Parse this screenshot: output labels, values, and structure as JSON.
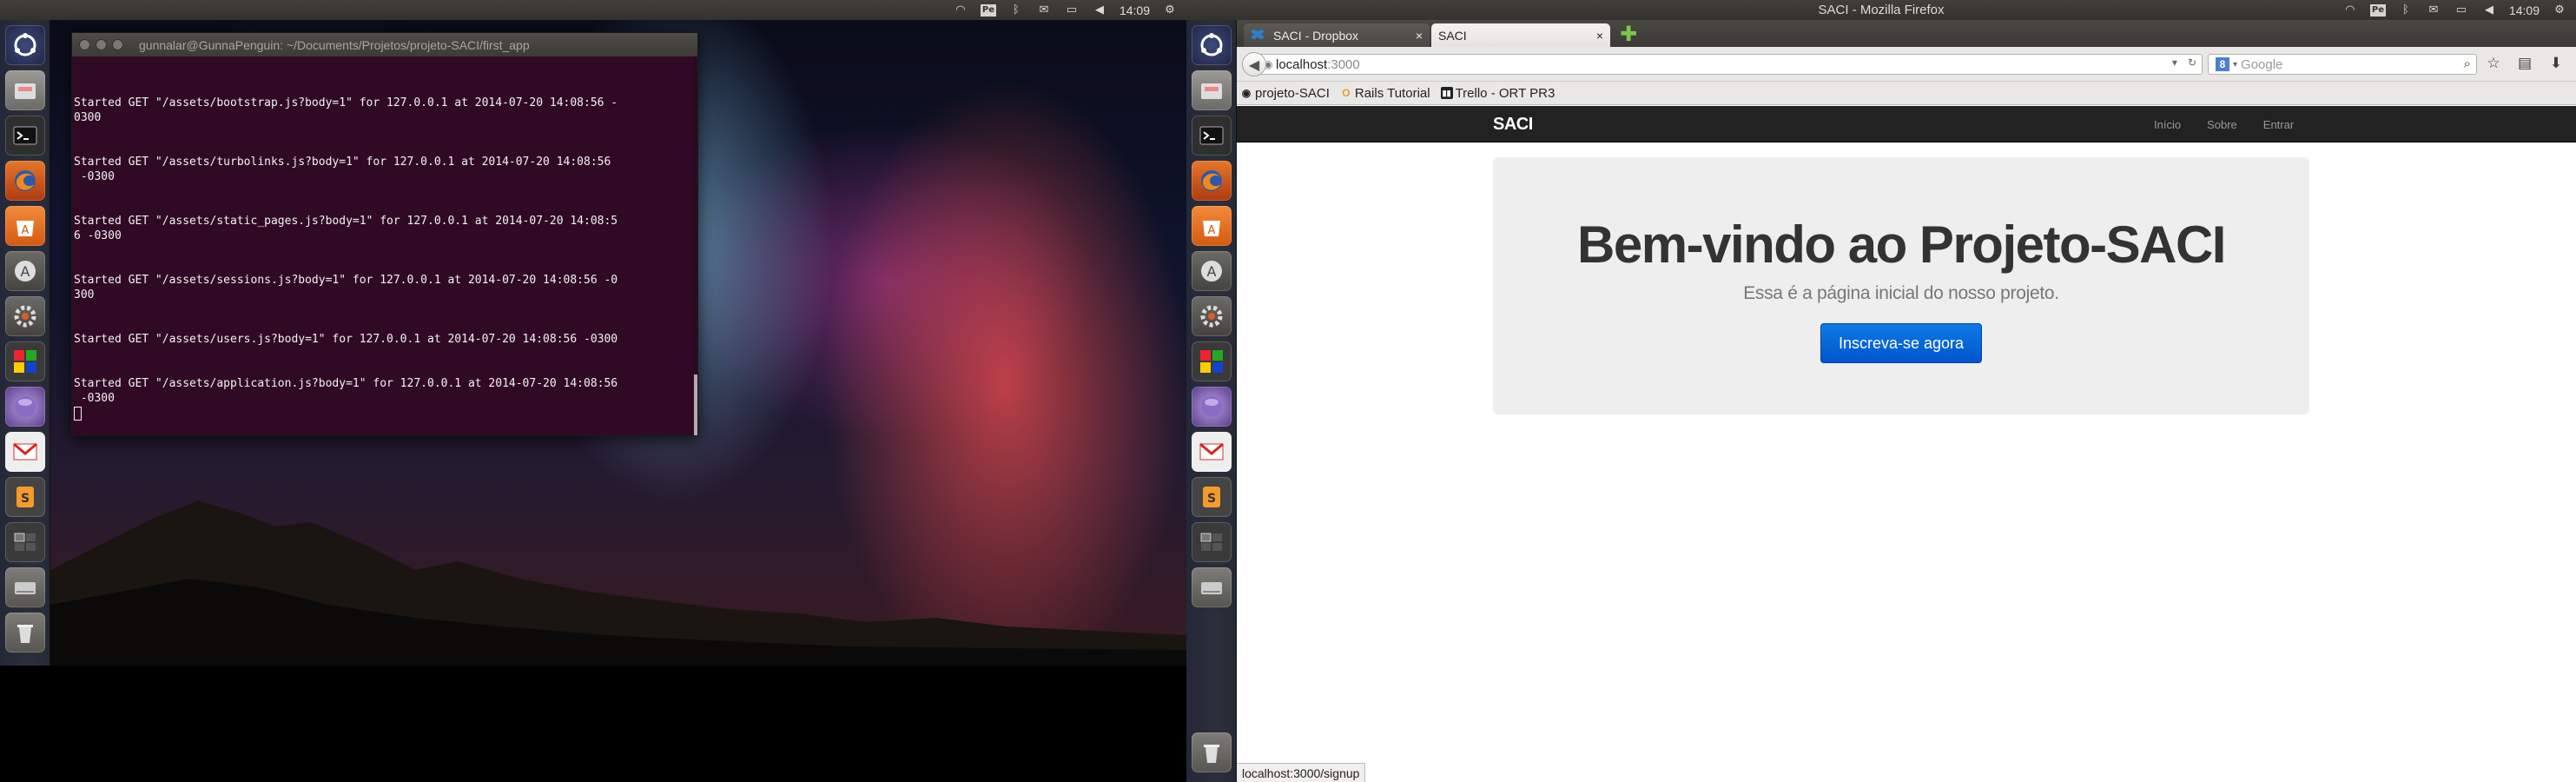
{
  "left_screen": {
    "panel": {
      "time": "14:09",
      "tray_icons": [
        "wifi-icon",
        "pe-icon",
        "bluetooth-icon",
        "mail-icon",
        "battery-icon",
        "volume-icon",
        "gear-icon"
      ]
    },
    "launcher": {
      "items": [
        {
          "name": "dash-home-icon"
        },
        {
          "name": "files-icon"
        },
        {
          "name": "terminal-icon"
        },
        {
          "name": "firefox-icon"
        },
        {
          "name": "software-center-icon"
        },
        {
          "name": "update-manager-icon"
        },
        {
          "name": "system-settings-icon"
        },
        {
          "name": "office-apps-icon"
        },
        {
          "name": "orb-app-icon"
        },
        {
          "name": "gmail-icon"
        },
        {
          "name": "sublime-text-icon"
        },
        {
          "name": "workspace-switcher-icon"
        },
        {
          "name": "drive-icon"
        },
        {
          "name": "trash-icon"
        }
      ]
    },
    "terminal": {
      "title": "gunnalar@GunnaPenguin: ~/Documents/Projetos/projeto-SACI/first_app",
      "lines": [
        "",
        "Started GET \"/assets/bootstrap.js?body=1\" for 127.0.0.1 at 2014-07-20 14:08:56 -",
        "0300",
        "",
        "",
        "Started GET \"/assets/turbolinks.js?body=1\" for 127.0.0.1 at 2014-07-20 14:08:56",
        " -0300",
        "",
        "",
        "Started GET \"/assets/static_pages.js?body=1\" for 127.0.0.1 at 2014-07-20 14:08:5",
        "6 -0300",
        "",
        "",
        "Started GET \"/assets/sessions.js?body=1\" for 127.0.0.1 at 2014-07-20 14:08:56 -0",
        "300",
        "",
        "",
        "Started GET \"/assets/users.js?body=1\" for 127.0.0.1 at 2014-07-20 14:08:56 -0300",
        "",
        "",
        "Started GET \"/assets/application.js?body=1\" for 127.0.0.1 at 2014-07-20 14:08:56",
        " -0300"
      ]
    }
  },
  "right_screen": {
    "panel": {
      "window_title": "SACI - Mozilla Firefox",
      "time": "14:09"
    },
    "firefox": {
      "tabs": [
        {
          "label": "SACI - Dropbox",
          "close": "×"
        },
        {
          "label": "SACI",
          "close": "×"
        }
      ],
      "new_tab": "✚",
      "url_host": "localhost",
      "url_port": ":3000",
      "search_placeholder": "Google",
      "search_engine": "8",
      "bookmarks": [
        {
          "label": "projeto-SACI",
          "icon": "github-icon"
        },
        {
          "label": "Rails Tutorial",
          "icon": "railstutorial-icon"
        },
        {
          "label": "Trello - ORT PR3",
          "icon": "trello-icon"
        }
      ],
      "status_url": "localhost:3000/signup"
    },
    "page": {
      "brand": "SACI",
      "nav": [
        "Início",
        "Sobre",
        "Entrar"
      ],
      "heading": "Bem-vindo ao Projeto-SACI",
      "subheading": "Essa é a página inicial do nosso projeto.",
      "cta": "Inscreva-se agora",
      "colors": {
        "navbar": "#222222",
        "jumbotron": "#eeeeee",
        "button": "#0063d6"
      }
    }
  }
}
